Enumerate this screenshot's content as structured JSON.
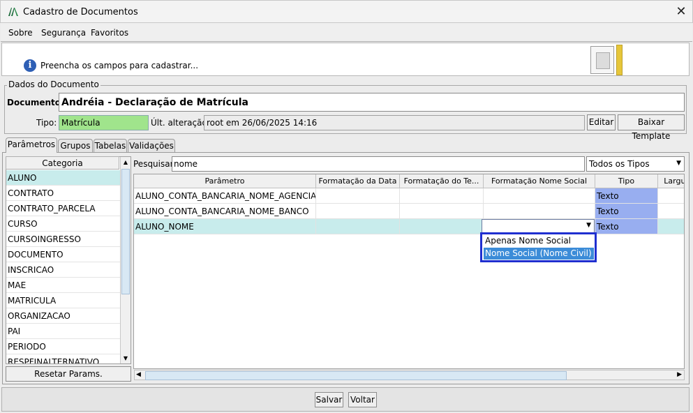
{
  "window": {
    "title": "Cadastro de Documentos",
    "close_glyph": "✕"
  },
  "menu": [
    "Sobre",
    "Segurança",
    "Favoritos"
  ],
  "header": {
    "info_text": "Preencha os campos para cadastrar...",
    "info_glyph": "i"
  },
  "group": {
    "title": "Dados do Documento",
    "documento_label": "Documento:",
    "documento_value": "Andréia - Declaração de Matrícula",
    "tipo_label": "Tipo:",
    "tipo_value": "Matrícula",
    "ult_label": "Últ. alteração:",
    "ult_value": "root em 26/06/2025 14:16",
    "edit_label": "Editar",
    "download_label": "Baixar Template"
  },
  "tabs": [
    "Parâmetros",
    "Grupos",
    "Tabelas",
    "Validações"
  ],
  "category": {
    "header": "Categoria",
    "items": [
      "ALUNO",
      "CONTRATO",
      "CONTRATO_PARCELA",
      "CURSO",
      "CURSOINGRESSO",
      "DOCUMENTO",
      "INSCRICAO",
      "MAE",
      "MATRICULA",
      "ORGANIZACAO",
      "PAI",
      "PERIODO",
      "RESPFINALTERNATIVO"
    ],
    "selected": "ALUNO",
    "reset_label": "Resetar Params."
  },
  "search": {
    "label": "Pesquisar:",
    "value": "nome",
    "type_filter": "Todos os Tipos"
  },
  "table": {
    "columns": [
      "Parâmetro",
      "Formatação da Data",
      "Formatação do Te...",
      "Formatação Nome Social",
      "Tipo",
      "Largura"
    ],
    "rows": [
      {
        "param": "ALUNO_CONTA_BANCARIA_NOME_AGENCIA",
        "tipo": "Texto"
      },
      {
        "param": "ALUNO_CONTA_BANCARIA_NOME_BANCO",
        "tipo": "Texto"
      },
      {
        "param": "ALUNO_NOME",
        "tipo": "Texto"
      }
    ],
    "dropdown_options": [
      "Apenas Nome Social",
      "Nome Social (Nome Civil)"
    ],
    "dropdown_highlighted": "Nome Social (Nome Civil)"
  },
  "footer": {
    "save_label": "Salvar",
    "back_label": "Voltar"
  },
  "colors": {
    "tipo_green": "#a0e48c",
    "selection": "#c8ecec",
    "tipo_blue": "#98aef0",
    "dropdown_border": "#1f2fd0",
    "highlight": "#3c8cd8"
  }
}
